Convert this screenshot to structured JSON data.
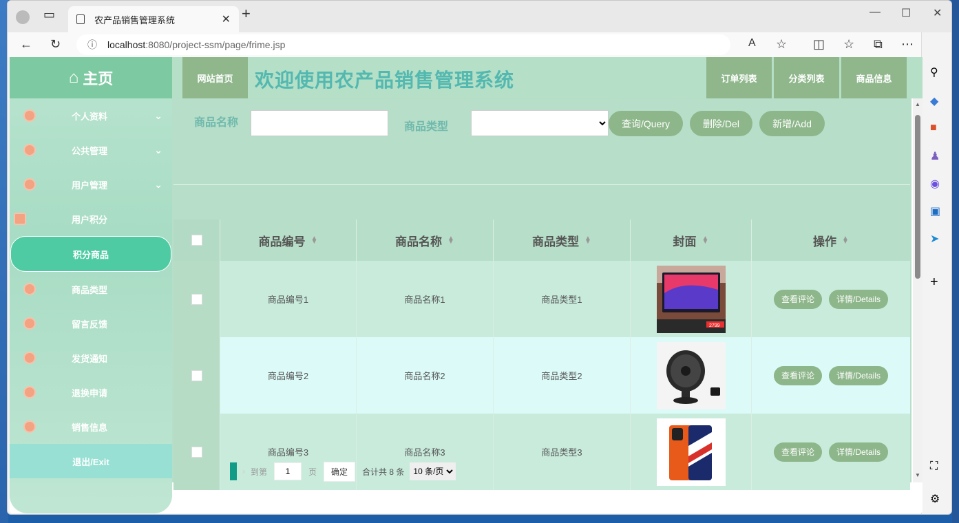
{
  "browser": {
    "tab_title": "农产品销售管理系统",
    "url_host": "localhost",
    "url_path": ":8080/project-ssm/page/frime.jsp"
  },
  "sidebar": {
    "logo": "主页",
    "items": [
      {
        "label": "个人资料",
        "expand": true
      },
      {
        "label": "公共管理",
        "expand": true
      },
      {
        "label": "用户管理",
        "expand": true
      },
      {
        "label": "用户积分",
        "expand": false
      },
      {
        "label": "积分商品",
        "expand": false,
        "active": true
      },
      {
        "label": "商品类型",
        "expand": false
      },
      {
        "label": "留言反馈",
        "expand": false
      },
      {
        "label": "发货通知",
        "expand": false
      },
      {
        "label": "退换申请",
        "expand": false
      },
      {
        "label": "销售信息",
        "expand": false
      }
    ],
    "exit": "退出/Exit"
  },
  "header": {
    "home": "网站首页",
    "title": "欢迎使用农产品销售管理系统",
    "nav": [
      "订单列表",
      "分类列表",
      "商品信息"
    ]
  },
  "search": {
    "name_label": "商品名称",
    "type_label": "商品类型",
    "query": "查询/Query",
    "delete": "删除/Del",
    "add": "新增/Add"
  },
  "table": {
    "headers": [
      "商品编号",
      "商品名称",
      "商品类型",
      "封面",
      "操作"
    ],
    "rows": [
      {
        "id": "商品编号1",
        "name": "商品名称1",
        "type": "商品类型1",
        "cover": "monitor"
      },
      {
        "id": "商品编号2",
        "name": "商品名称2",
        "type": "商品类型2",
        "cover": "fan"
      },
      {
        "id": "商品编号3",
        "name": "商品名称3",
        "type": "商品类型3",
        "cover": "phone"
      }
    ],
    "action_review": "查看评论",
    "action_details": "详情/Details",
    "monitor_price": "2799"
  },
  "pager": {
    "goto": "到第",
    "page_value": "1",
    "page_unit": "页",
    "confirm": "确定",
    "total": "合计共 8 条",
    "per_page": "10 条/页"
  },
  "colors": {
    "accent": "#8db68a",
    "active_menu": "#4ecba3",
    "title": "#52b8b0"
  }
}
